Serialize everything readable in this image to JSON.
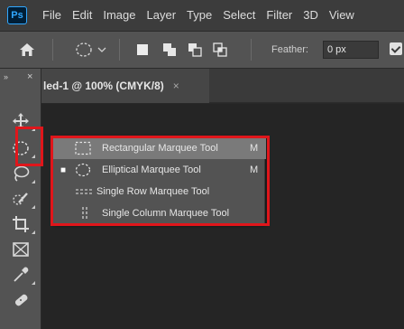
{
  "app": {
    "logo_text": "Ps"
  },
  "menubar": {
    "items": [
      "File",
      "Edit",
      "Image",
      "Layer",
      "Type",
      "Select",
      "Filter",
      "3D",
      "View"
    ]
  },
  "options_bar": {
    "icons": [
      "home-icon",
      "elliptical-marquee-icon",
      "new-selection-icon",
      "add-to-selection-icon",
      "subtract-from-selection-icon",
      "intersect-with-selection-icon"
    ],
    "feather_label": "Feather:",
    "feather_value": "0 px",
    "anti_alias_checked": true
  },
  "document_tab": {
    "title": "led-1 @ 100% (CMYK/8)",
    "close_glyph": "×"
  },
  "tool_panel": {
    "collapse_glyph": "»",
    "close_glyph": "×",
    "tools": [
      "move-icon",
      "elliptical-marquee-icon",
      "lasso-icon",
      "quick-selection-icon",
      "crop-icon",
      "frame-icon",
      "eyedropper-icon",
      "spot-healing-icon"
    ]
  },
  "flyout": {
    "items": [
      {
        "label": "Rectangular Marquee Tool",
        "shortcut": "M",
        "icon": "rectangular-marquee-icon",
        "active": false,
        "hover": true
      },
      {
        "label": "Elliptical Marquee Tool",
        "shortcut": "M",
        "icon": "elliptical-marquee-icon",
        "active": true,
        "hover": false
      },
      {
        "label": "Single Row Marquee Tool",
        "shortcut": "",
        "icon": "single-row-marquee-icon",
        "active": false,
        "hover": false
      },
      {
        "label": "Single Column Marquee Tool",
        "shortcut": "",
        "icon": "single-column-marquee-icon",
        "active": false,
        "hover": false
      }
    ]
  },
  "colors": {
    "highlight": "#e0161b",
    "panel": "#535353",
    "menubar": "#3c3c3c",
    "canvas": "#252525"
  }
}
